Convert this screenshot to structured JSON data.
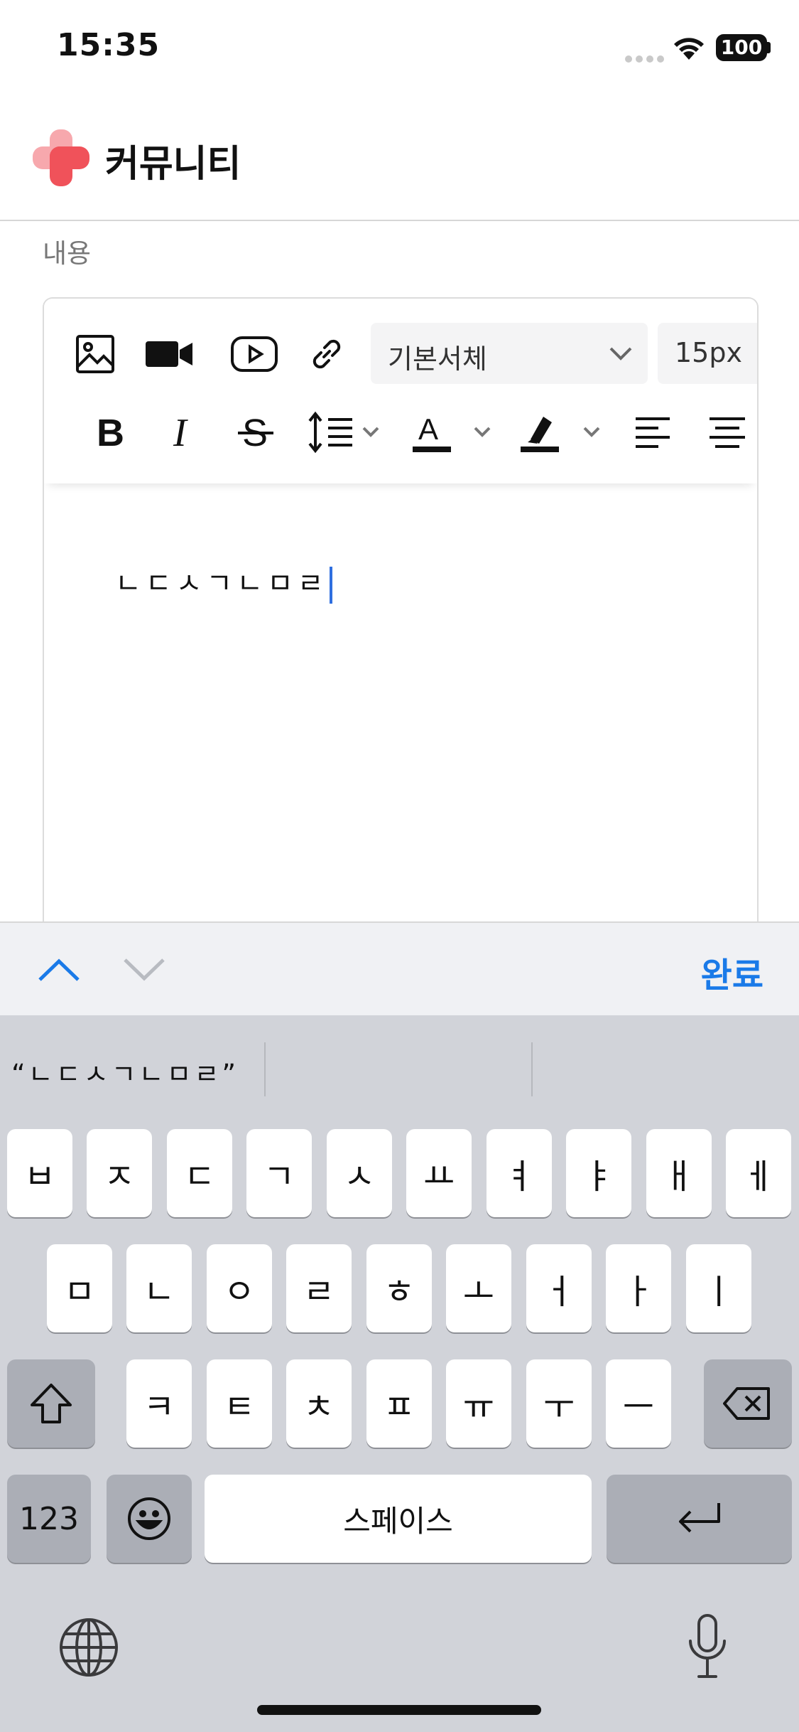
{
  "status_bar": {
    "time": "15:35",
    "battery": "100"
  },
  "header": {
    "title": "커뮤니티"
  },
  "form": {
    "content_label": "내용"
  },
  "toolbar": {
    "font_family": "기본서체",
    "font_size": "15px"
  },
  "editor": {
    "text": "ㄴㄷㅅㄱㄴㅁㄹ"
  },
  "accessory_bar": {
    "done_label": "완료"
  },
  "keyboard": {
    "suggestion": "“ㄴㄷㅅㄱㄴㅁㄹ”",
    "row1": [
      "ㅂ",
      "ㅈ",
      "ㄷ",
      "ㄱ",
      "ㅅ",
      "ㅛ",
      "ㅕ",
      "ㅑ",
      "ㅐ",
      "ㅔ"
    ],
    "row2": [
      "ㅁ",
      "ㄴ",
      "ㅇ",
      "ㄹ",
      "ㅎ",
      "ㅗ",
      "ㅓ",
      "ㅏ",
      "ㅣ"
    ],
    "row3": [
      "ㅋ",
      "ㅌ",
      "ㅊ",
      "ㅍ",
      "ㅠ",
      "ㅜ",
      "ㅡ"
    ],
    "numbers_label": "123",
    "space_label": "스페이스"
  },
  "colors": {
    "accent": "#1a7ae8",
    "logo_red": "#f0525a",
    "logo_pink": "#f7a8ad",
    "caret": "#2f6fe0"
  }
}
